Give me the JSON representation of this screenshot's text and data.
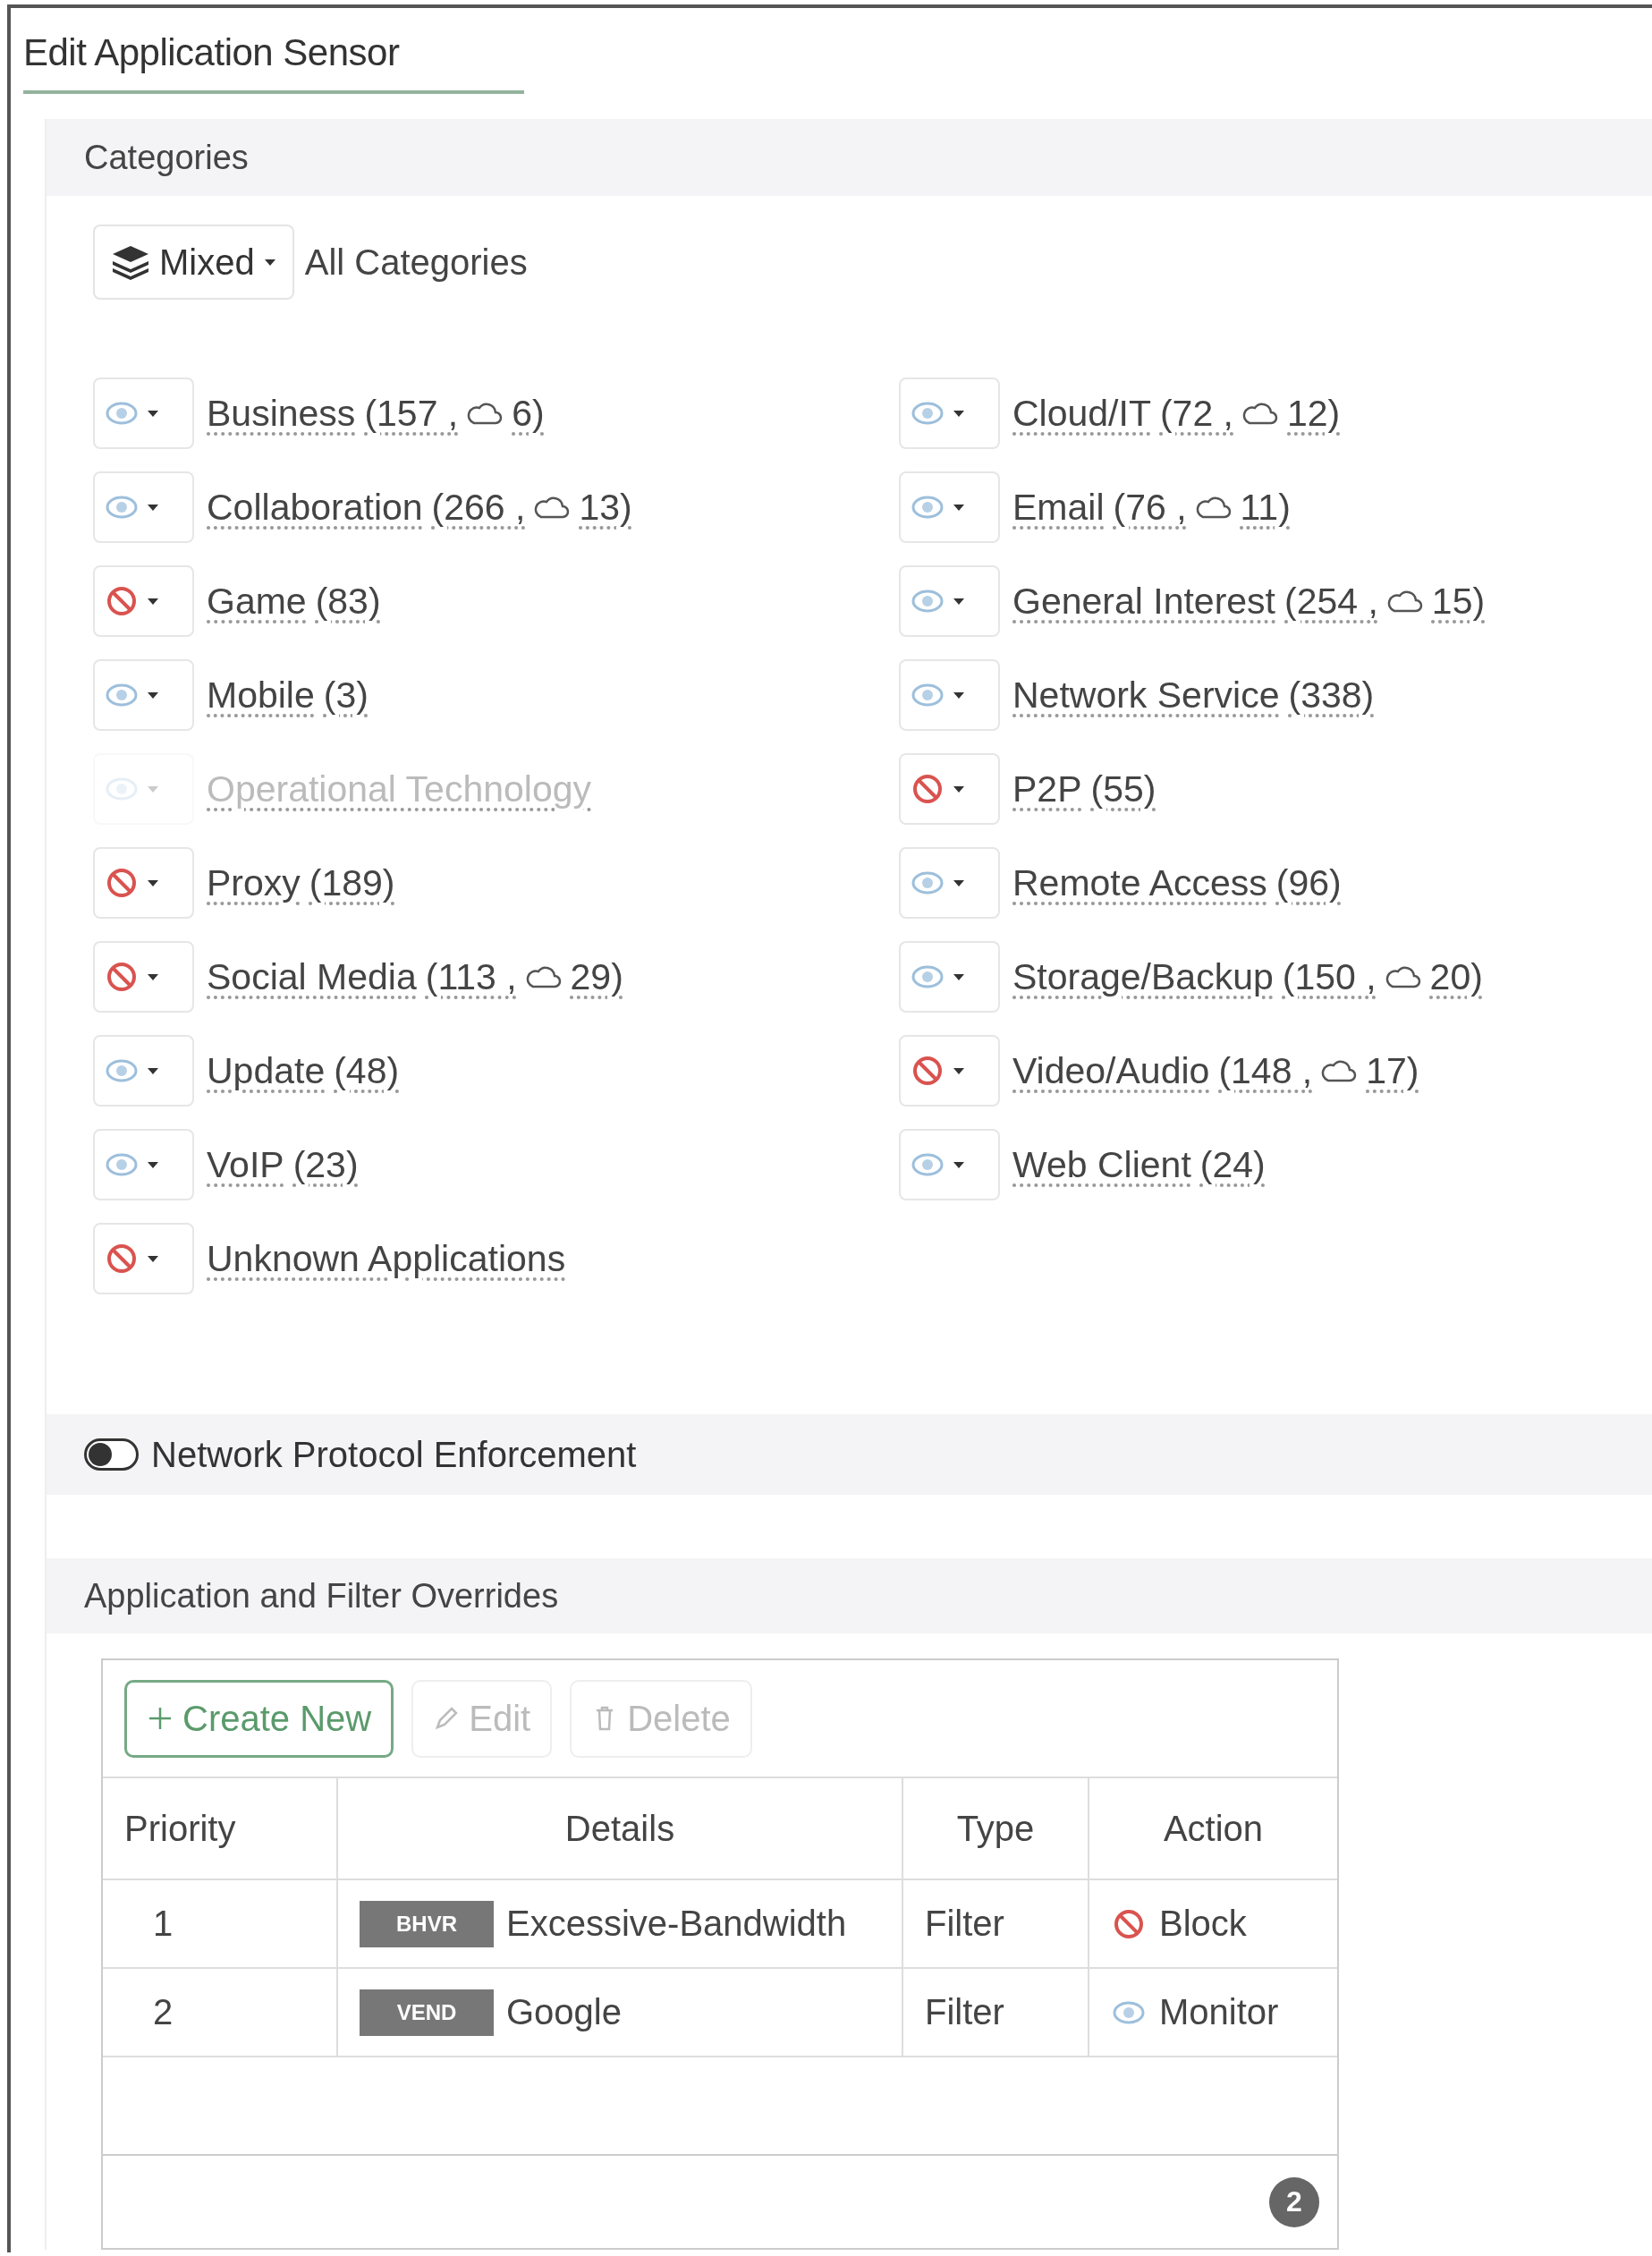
{
  "dialog": {
    "title": "Edit Application Sensor"
  },
  "categories": {
    "title": "Categories",
    "all": {
      "label": "Mixed",
      "caption": "All Categories"
    },
    "items": [
      {
        "name": "Business",
        "count_text": "(157 ,",
        "cloud_text": "6)",
        "blocked": false,
        "disabled": false
      },
      {
        "name": "Cloud/IT",
        "count_text": "(72 ,",
        "cloud_text": "12)",
        "blocked": false,
        "disabled": false
      },
      {
        "name": "Collaboration",
        "count_text": "(266 ,",
        "cloud_text": "13)",
        "blocked": false,
        "disabled": false
      },
      {
        "name": "Email",
        "count_text": "(76 ,",
        "cloud_text": "11)",
        "blocked": false,
        "disabled": false
      },
      {
        "name": "Game",
        "count_text": "(83)",
        "blocked": true,
        "disabled": false
      },
      {
        "name": "General Interest",
        "count_text": "(254 ,",
        "cloud_text": "15)",
        "blocked": false,
        "disabled": false
      },
      {
        "name": "Mobile",
        "count_text": "(3)",
        "blocked": false,
        "disabled": false
      },
      {
        "name": "Network Service",
        "count_text": "(338)",
        "blocked": false,
        "disabled": false
      },
      {
        "name": "Operational Technology",
        "blocked": false,
        "disabled": true
      },
      {
        "name": "P2P",
        "count_text": "(55)",
        "blocked": true,
        "disabled": false
      },
      {
        "name": "Proxy",
        "count_text": "(189)",
        "blocked": true,
        "disabled": false
      },
      {
        "name": "Remote Access",
        "count_text": "(96)",
        "blocked": false,
        "disabled": false
      },
      {
        "name": "Social Media",
        "count_text": "(113 ,",
        "cloud_text": "29)",
        "blocked": true,
        "disabled": false
      },
      {
        "name": "Storage/Backup",
        "count_text": "(150 ,",
        "cloud_text": "20)",
        "blocked": false,
        "disabled": false
      },
      {
        "name": "Update",
        "count_text": "(48)",
        "blocked": false,
        "disabled": false
      },
      {
        "name": "Video/Audio",
        "count_text": "(148 ,",
        "cloud_text": "17)",
        "blocked": true,
        "disabled": false
      },
      {
        "name": "VoIP",
        "count_text": "(23)",
        "blocked": false,
        "disabled": false
      },
      {
        "name": "Web Client",
        "count_text": "(24)",
        "blocked": false,
        "disabled": false
      },
      {
        "name": "Unknown Applications",
        "blocked": true,
        "disabled": false
      }
    ]
  },
  "protocol_enforcement": {
    "label": "Network Protocol Enforcement",
    "on": false
  },
  "overrides": {
    "title": "Application and Filter Overrides",
    "toolbar": [
      {
        "kind": "create",
        "label": "Create New",
        "disabled": false
      },
      {
        "kind": "edit",
        "label": "Edit",
        "disabled": true
      },
      {
        "kind": "delete",
        "label": "Delete",
        "disabled": true
      }
    ],
    "columns": [
      "Priority",
      "Details",
      "Type",
      "Action"
    ],
    "rows": [
      {
        "priority": "1",
        "tag": "BHVR",
        "detail": "Excessive-Bandwidth",
        "type": "Filter",
        "blocked": true,
        "action_label": "Block"
      },
      {
        "priority": "2",
        "tag": "VEND",
        "detail": "Google",
        "type": "Filter",
        "blocked": false,
        "action_label": "Monitor"
      }
    ],
    "footer_count": "2"
  }
}
